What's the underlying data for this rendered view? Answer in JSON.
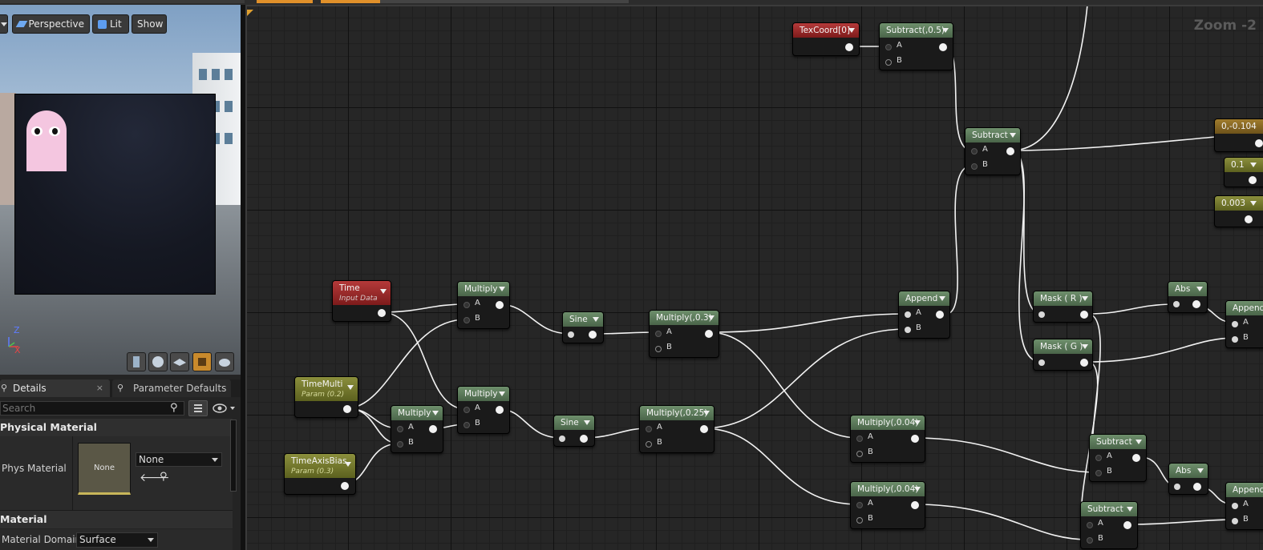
{
  "toolbar": {
    "perspective_label": "Perspective",
    "lit_label": "Lit",
    "show_label": "Show"
  },
  "viewport": {
    "axis_z": "Z",
    "axis_x": "X"
  },
  "tabs": {
    "details": "Details",
    "parameter_defaults": "Parameter Defaults"
  },
  "details": {
    "search_placeholder": "Search",
    "physical_material_section": "Physical Material",
    "phys_material_label": "Phys Material",
    "thumbnail_text": "None",
    "phys_material_value": "None",
    "material_section": "Material",
    "material_domain_label": "Material Domain",
    "material_domain_value": "Surface"
  },
  "graph": {
    "zoom_label": "Zoom -2",
    "nodes": {
      "texcoord": {
        "title": "TexCoord[0]"
      },
      "subtract_05": {
        "title": "Subtract(,0.5)",
        "pin_a": "A",
        "pin_b": "B"
      },
      "subtract_main": {
        "title": "Subtract",
        "pin_a": "A",
        "pin_b": "B"
      },
      "const_0_104": {
        "title": "0,-0.104"
      },
      "const_0_1": {
        "title": "0.1"
      },
      "const_0_003": {
        "title": "0.003"
      },
      "time": {
        "title": "Time",
        "subtitle": "Input Data"
      },
      "multiply_1": {
        "title": "Multiply",
        "pin_a": "A",
        "pin_b": "B"
      },
      "sine_1": {
        "title": "Sine"
      },
      "multiply_03": {
        "title": "Multiply(,0.3)",
        "pin_a": "A",
        "pin_b": "B"
      },
      "append_1": {
        "title": "Append",
        "pin_a": "A",
        "pin_b": "B"
      },
      "mask_r": {
        "title": "Mask ( R )"
      },
      "abs_1": {
        "title": "Abs"
      },
      "append_right_1": {
        "title": "Append",
        "pin_a": "A",
        "pin_b": "B"
      },
      "mask_g": {
        "title": "Mask ( G )"
      },
      "timemulti": {
        "title": "TimeMulti",
        "subtitle": "Param (0.2)"
      },
      "multiply_2": {
        "title": "Multiply",
        "pin_a": "A",
        "pin_b": "B"
      },
      "multiply_3": {
        "title": "Multiply",
        "pin_a": "A",
        "pin_b": "B"
      },
      "sine_2": {
        "title": "Sine"
      },
      "multiply_025": {
        "title": "Multiply(,0.25)",
        "pin_a": "A",
        "pin_b": "B"
      },
      "multiply_004_a": {
        "title": "Multiply(,0.04)",
        "pin_a": "A",
        "pin_b": "B"
      },
      "subtract_2": {
        "title": "Subtract",
        "pin_a": "A",
        "pin_b": "B"
      },
      "abs_2": {
        "title": "Abs"
      },
      "append_right_2": {
        "title": "Append",
        "pin_a": "A",
        "pin_b": "B"
      },
      "timeaxisbias": {
        "title": "TimeAxisBias",
        "subtitle": "Param (0.3)"
      },
      "multiply_004_b": {
        "title": "Multiply(,0.04)",
        "pin_a": "A",
        "pin_b": "B"
      },
      "subtract_3": {
        "title": "Subtract",
        "pin_a": "A",
        "pin_b": "B"
      }
    }
  },
  "colors": {
    "graph_bg": "#262626",
    "node_green": "#5b7a59",
    "node_red": "#9a2828",
    "node_olive": "#6f7530",
    "node_gold": "#8a6a22",
    "accent_orange": "#e0902a",
    "wire": "#ffffff"
  }
}
